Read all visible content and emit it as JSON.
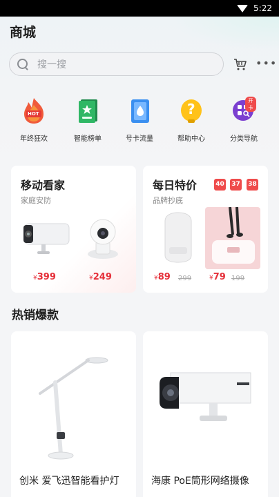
{
  "status_bar": {
    "time": "5:22"
  },
  "header": {
    "title": "商城"
  },
  "search": {
    "placeholder": "搜一搜"
  },
  "categories": [
    {
      "label": "年终狂欢",
      "icon": "hot-icon",
      "badge": "HOT"
    },
    {
      "label": "智能榜单",
      "icon": "ranking-book-icon"
    },
    {
      "label": "号卡流量",
      "icon": "sim-card-icon"
    },
    {
      "label": "帮助中心",
      "icon": "help-icon",
      "symbol": "?"
    },
    {
      "label": "分类导航",
      "icon": "category-nav-icon",
      "badge": "开卡"
    }
  ],
  "promo_home": {
    "title": "移动看家",
    "subtitle": "家庭安防",
    "items": [
      {
        "price": "399",
        "currency": "¥"
      },
      {
        "price": "249",
        "currency": "¥"
      }
    ]
  },
  "promo_daily": {
    "title": "每日特价",
    "subtitle": "品牌抄底",
    "countdown": [
      "40",
      "37",
      "38"
    ],
    "items": [
      {
        "price": "89",
        "old_price": "299",
        "currency": "¥"
      },
      {
        "price": "79",
        "old_price": "199",
        "currency": "¥"
      }
    ]
  },
  "hot": {
    "title": "热销爆款",
    "products": [
      {
        "name": "创米 爱飞迅智能看护灯"
      },
      {
        "name": "海康 PoE筒形网络摄像"
      }
    ]
  },
  "colors": {
    "accent_red": "#e5303a",
    "timer_red": "#ef4b4b"
  }
}
